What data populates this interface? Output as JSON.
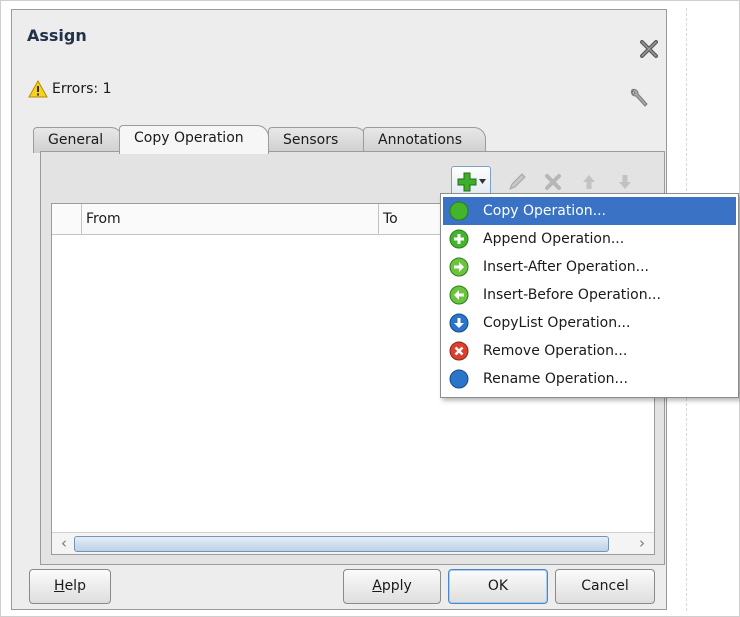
{
  "dialog": {
    "title": "Assign",
    "errors_label": "Errors: 1"
  },
  "tabs": [
    {
      "label": "General",
      "active": false
    },
    {
      "label": "Copy Operation",
      "active": true
    },
    {
      "label": "Sensors",
      "active": false
    },
    {
      "label": "Annotations",
      "active": false
    }
  ],
  "table": {
    "columns": [
      "From",
      "To"
    ]
  },
  "menu": {
    "items": [
      {
        "label": "Copy Operation...",
        "icon": "green-circle-icon",
        "selected": true
      },
      {
        "label": "Append Operation...",
        "icon": "green-plus-circle-icon",
        "selected": false
      },
      {
        "label": "Insert-After Operation...",
        "icon": "green-arrow-right-circle-icon",
        "selected": false
      },
      {
        "label": "Insert-Before Operation...",
        "icon": "green-arrow-left-circle-icon",
        "selected": false
      },
      {
        "label": "CopyList Operation...",
        "icon": "blue-arrow-down-circle-icon",
        "selected": false
      },
      {
        "label": "Remove Operation...",
        "icon": "red-x-circle-icon",
        "selected": false
      },
      {
        "label": "Rename Operation...",
        "icon": "blue-circle-icon",
        "selected": false
      }
    ]
  },
  "buttons": {
    "help": {
      "label": "Help",
      "mnemonic": "H",
      "rest": "elp"
    },
    "apply": {
      "label": "Apply",
      "mnemonic": "A",
      "rest": "pply"
    },
    "ok": {
      "label": "OK"
    },
    "cancel": {
      "label": "Cancel"
    }
  },
  "colors": {
    "selection": "#3a72c6",
    "accent_green": "#3fae2a",
    "accent_blue": "#2a74c9",
    "accent_red": "#d9412e"
  }
}
